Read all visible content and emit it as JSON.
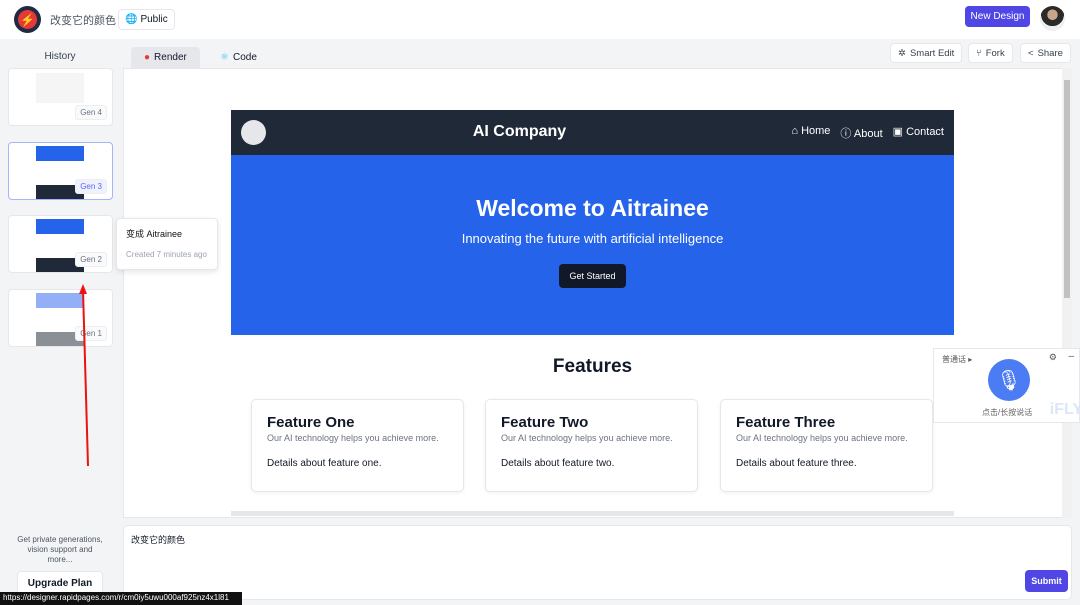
{
  "header": {
    "title": "改变它的颜色",
    "visibility": "Public",
    "new_design": "New Design"
  },
  "sidebar": {
    "history_label": "History",
    "items": [
      {
        "label": "Gen 4"
      },
      {
        "label": "Gen 3"
      },
      {
        "label": "Gen 2"
      },
      {
        "label": "Gen 1"
      }
    ],
    "tooltip": {
      "title": "变成 Aitrainee",
      "meta": "Created 7 minutes ago"
    },
    "upsell": "Get private generations, vision support and more...",
    "upgrade": "Upgrade Plan"
  },
  "tabs": [
    {
      "label": "Render"
    },
    {
      "label": "Code"
    }
  ],
  "toolbar": {
    "smart_edit": "Smart Edit",
    "fork": "Fork",
    "share": "Share"
  },
  "preview": {
    "brand": "AI Company",
    "nav": [
      "Home",
      "About",
      "Contact"
    ],
    "hero_title": "Welcome to Aitrainee",
    "hero_sub": "Innovating the future with artificial intelligence",
    "cta": "Get Started",
    "features_title": "Features",
    "cards": [
      {
        "title": "Feature One",
        "sub": "Our AI technology helps you achieve more.",
        "detail": "Details about feature one."
      },
      {
        "title": "Feature Two",
        "sub": "Our AI technology helps you achieve more.",
        "detail": "Details about feature two."
      },
      {
        "title": "Feature Three",
        "sub": "Our AI technology helps you achieve more.",
        "detail": "Details about feature three."
      }
    ]
  },
  "voice": {
    "lang": "普通话",
    "hint": "点击/长按说话",
    "brand": "iFLY"
  },
  "prompt": {
    "value": "改变它的颜色",
    "submit": "Submit"
  },
  "status_url": "https://designer.rapidpages.com/r/cm0iy5uwu000af925nz4x1l81",
  "colors": {
    "accent": "#4f46e5",
    "hero": "#2563eb",
    "nav": "#1f2937"
  }
}
